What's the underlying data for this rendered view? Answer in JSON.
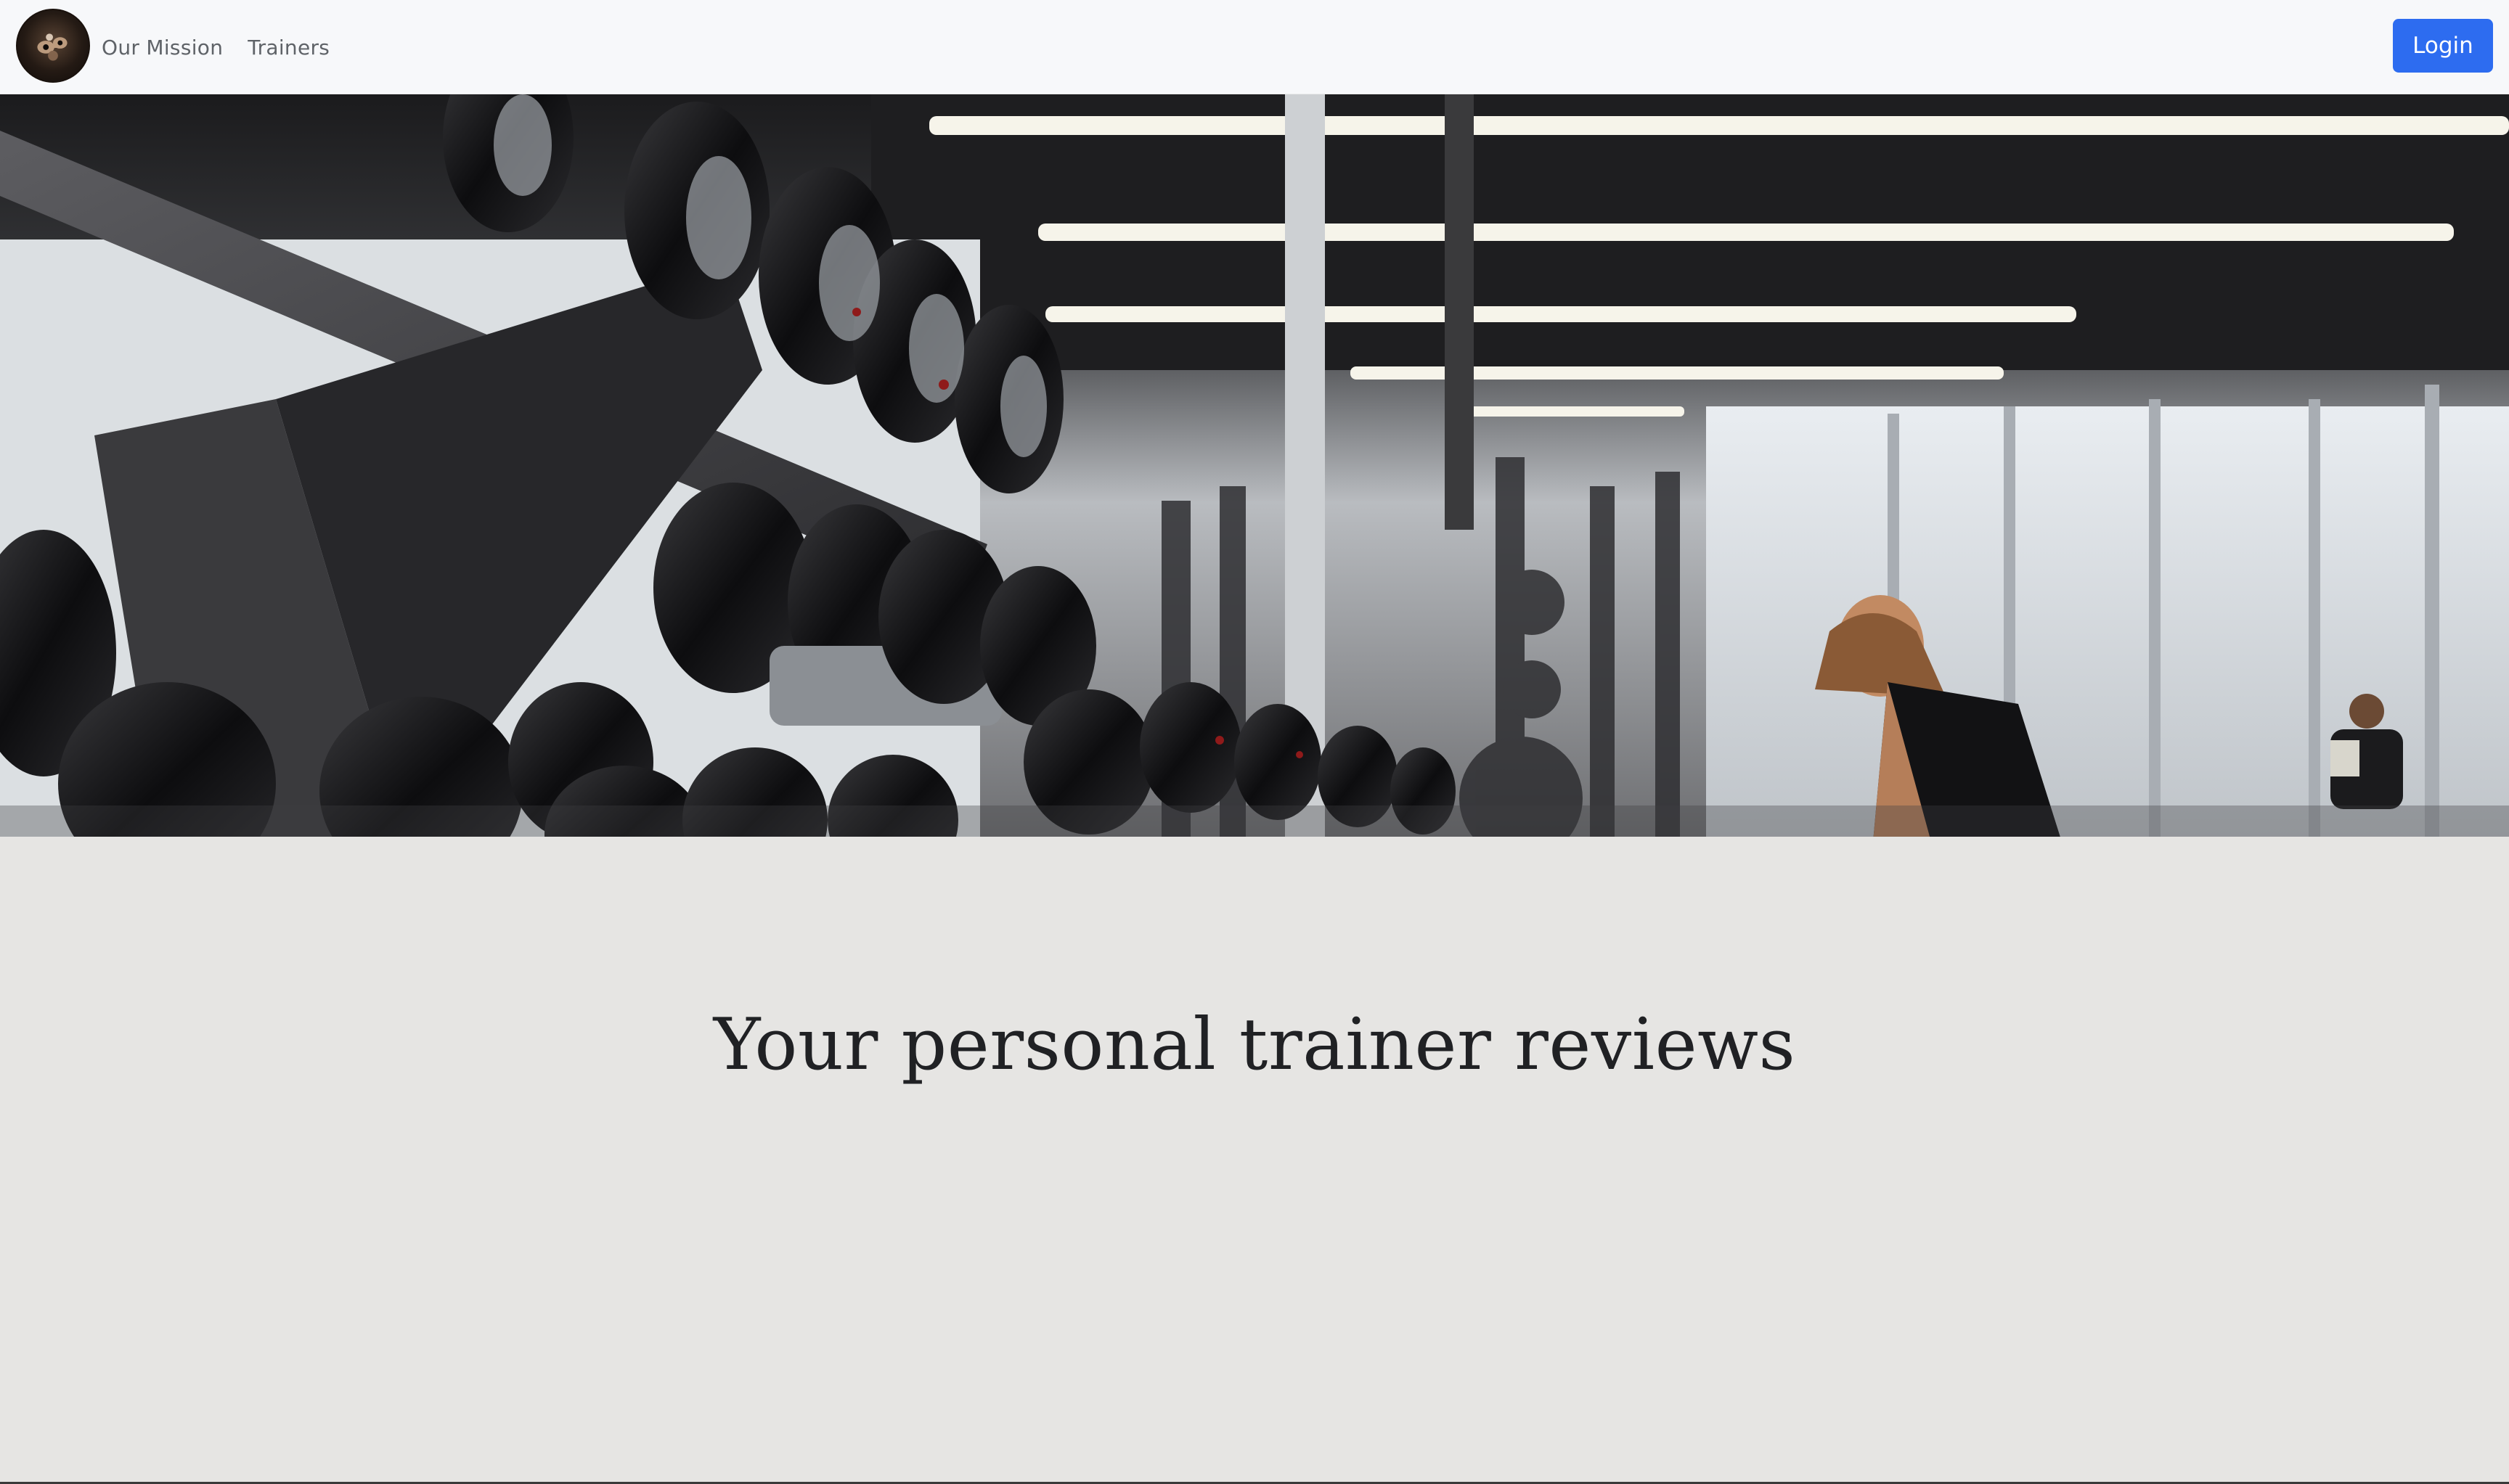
{
  "navbar": {
    "logo_icon": "gym-logo-icon",
    "links": [
      "Our Mission",
      "Trainers"
    ],
    "login_label": "Login",
    "login_color": "#2d6cf0"
  },
  "hero": {
    "image_subject": "gym-dumbbell-rack-photo"
  },
  "main": {
    "headline": "Your personal trainer reviews",
    "background_color": "#e6e5e3"
  }
}
